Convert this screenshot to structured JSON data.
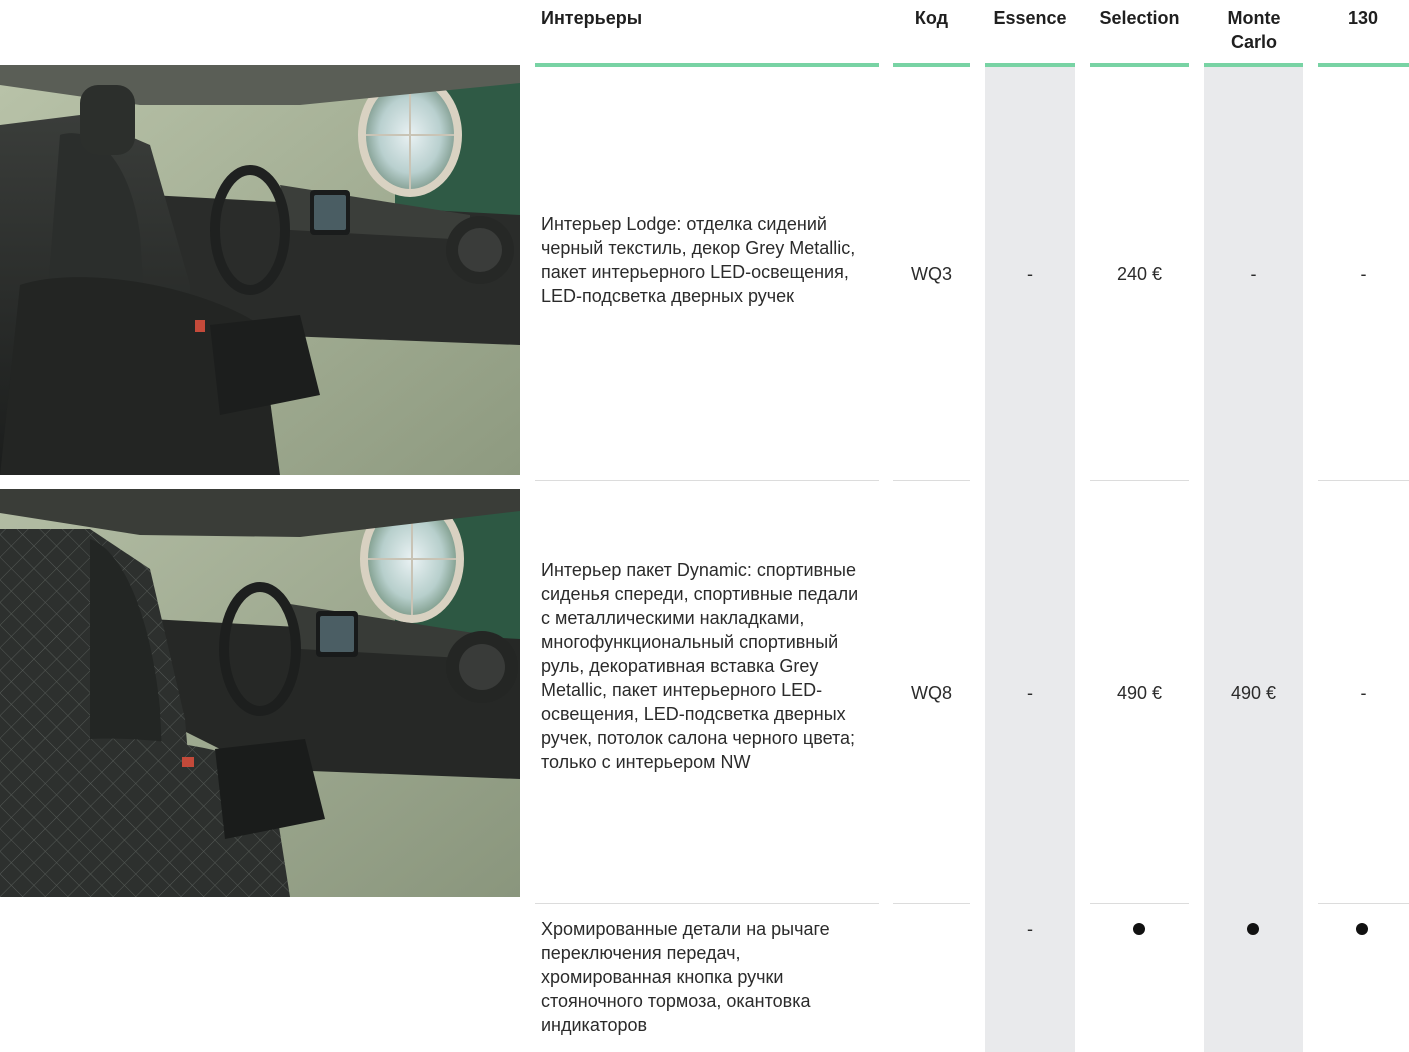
{
  "header": {
    "col_interiors": "Интерьеры",
    "col_code": "Код",
    "col_essence": "Essence",
    "col_selection": "Selection",
    "col_montecarlo": "Monte Carlo",
    "col_130": "130"
  },
  "rows": [
    {
      "description": "Интерьер Lodge: отделка сидений черный текстиль, декор Grey Metallic, пакет интерьерного LED-освещения, LED-подсветка дверных ручек",
      "code": "WQ3",
      "essence": "-",
      "selection": "240 €",
      "montecarlo": "-",
      "v130": "-"
    },
    {
      "description": "Интерьер пакет Dyna­mic: спортивные сиденья спереди, спортивные педали с металлическими накладками, многофункциональный спортивный руль, декоративная вставка Grey Metallic, пакет интерьерного LED-освещения, LED-подсветка дверных ручек, потолок салона черного цвета; только с интерьером NW",
      "code": "WQ8",
      "essence": "-",
      "selection": "490 €",
      "montecarlo": "490 €",
      "v130": "-"
    },
    {
      "description": "Хромированные детали на рычаге переключения передач, хромированная кнопка ручки стояночного тормоза, окантовка индикаторов",
      "code": "",
      "essence": "-",
      "selection": "standard",
      "montecarlo": "standard",
      "v130": "standard"
    }
  ],
  "colors": {
    "accent_green": "#78d3a4",
    "column_shade": "#e9eaec",
    "standard_dot": "#111111"
  },
  "icons": {
    "standard": "filled-dot-icon"
  }
}
